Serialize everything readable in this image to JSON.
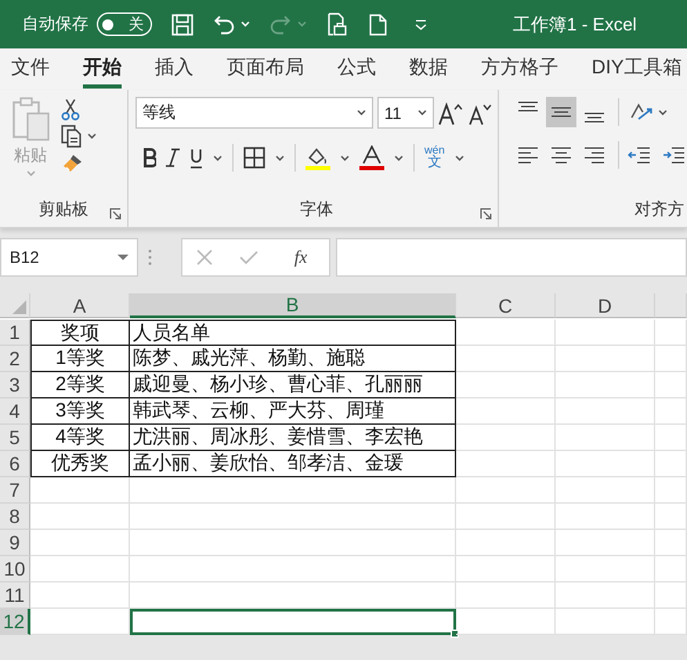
{
  "title_bar": {
    "autosave_label": "自动保存",
    "autosave_toggle": {
      "on": false,
      "label": "关"
    },
    "redo_disabled": true,
    "title": "工作簿1  -  Excel"
  },
  "tabs": [
    {
      "label": "文件",
      "selected": false
    },
    {
      "label": "开始",
      "selected": true
    },
    {
      "label": "插入",
      "selected": false
    },
    {
      "label": "页面布局",
      "selected": false
    },
    {
      "label": "公式",
      "selected": false
    },
    {
      "label": "数据",
      "selected": false
    },
    {
      "label": "方方格子",
      "selected": false
    },
    {
      "label": "DIY工具箱",
      "selected": false
    }
  ],
  "ribbon": {
    "clipboard": {
      "paste_label": "粘贴",
      "group_label": "剪贴板"
    },
    "font": {
      "font_name": "等线",
      "font_size": "11",
      "phonetic_top": "wén",
      "phonetic_bottom": "文",
      "group_label": "字体"
    },
    "alignment": {
      "vertical": [
        {
          "selected": false
        },
        {
          "selected": true
        },
        {
          "selected": false
        }
      ],
      "group_label": "对齐方"
    }
  },
  "formula_bar": {
    "name_box": "B12",
    "fx": "fx"
  },
  "sheet": {
    "columns": [
      {
        "label": "A",
        "selected": false
      },
      {
        "label": "B",
        "selected": true
      },
      {
        "label": "C",
        "selected": false
      },
      {
        "label": "D",
        "selected": false
      }
    ],
    "rows": [
      {
        "number": "1",
        "selected": false,
        "bordered": true,
        "cells": [
          "奖项",
          "人员名单"
        ]
      },
      {
        "number": "2",
        "selected": false,
        "bordered": true,
        "cells": [
          "1等奖",
          "陈梦、戚光萍、杨勤、施聪"
        ]
      },
      {
        "number": "3",
        "selected": false,
        "bordered": true,
        "cells": [
          "2等奖",
          "戚迎曼、杨小珍、曹心菲、孔丽丽"
        ]
      },
      {
        "number": "4",
        "selected": false,
        "bordered": true,
        "cells": [
          "3等奖",
          "韩武琴、云柳、严大芬、周瑾"
        ]
      },
      {
        "number": "5",
        "selected": false,
        "bordered": true,
        "cells": [
          "4等奖",
          "尤洪丽、周冰彤、姜惜雪、李宏艳"
        ]
      },
      {
        "number": "6",
        "selected": false,
        "bordered": true,
        "cells": [
          "优秀奖",
          "孟小丽、姜欣怡、邹孝洁、金瑗"
        ]
      },
      {
        "number": "7",
        "selected": false,
        "bordered": false
      },
      {
        "number": "8",
        "selected": false,
        "bordered": false
      },
      {
        "number": "9",
        "selected": false,
        "bordered": false
      },
      {
        "number": "10",
        "selected": false,
        "bordered": false
      },
      {
        "number": "11",
        "selected": false,
        "bordered": false
      },
      {
        "number": "12",
        "selected": true,
        "bordered": false
      }
    ]
  }
}
